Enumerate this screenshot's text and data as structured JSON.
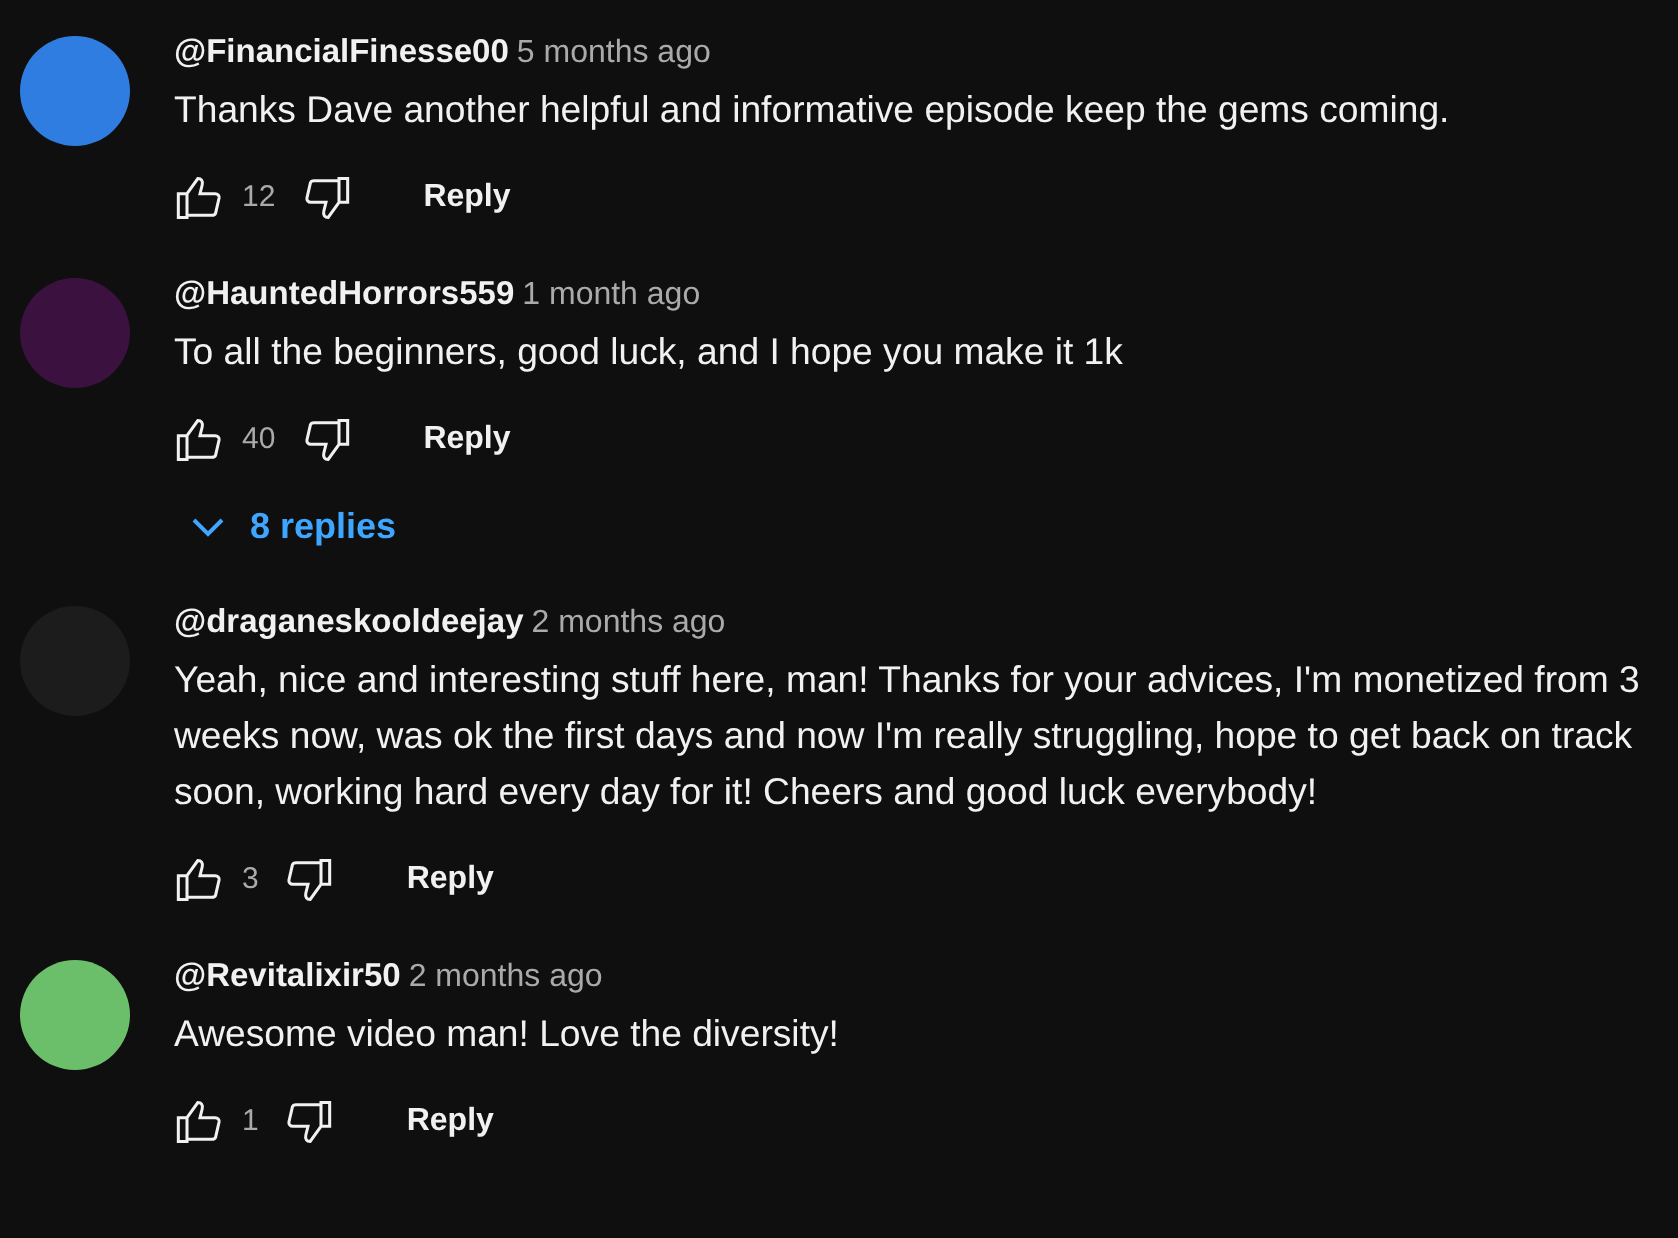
{
  "comments": [
    {
      "author": "@FinancialFinesse00",
      "time": "5 months ago",
      "text": "Thanks Dave another helpful and informative episode keep the gems coming.",
      "likes": "12",
      "reply": "Reply",
      "color": "#2f7de1"
    },
    {
      "author": "@HauntedHorrors559",
      "time": "1 month ago",
      "text": "To all the beginners, good luck, and I hope you make it 1k",
      "likes": "40",
      "reply": "Reply",
      "color": "#3b1140",
      "replies": "8 replies"
    },
    {
      "author": "@draganeskooldeejay",
      "time": "2 months ago",
      "text": "Yeah, nice and interesting stuff here, man! Thanks for your advices, I'm monetized from 3 weeks now, was ok the first days and now I'm really struggling, hope to get back on track soon, working hard every day for it! Cheers and good luck everybody!",
      "likes": "3",
      "reply": "Reply",
      "color": "#1c1c1c"
    },
    {
      "author": "@Revitalixir50",
      "time": "2 months ago",
      "text": "Awesome video man! Love the diversity!",
      "likes": "1",
      "reply": "Reply",
      "color": "#6cbf6a"
    }
  ]
}
